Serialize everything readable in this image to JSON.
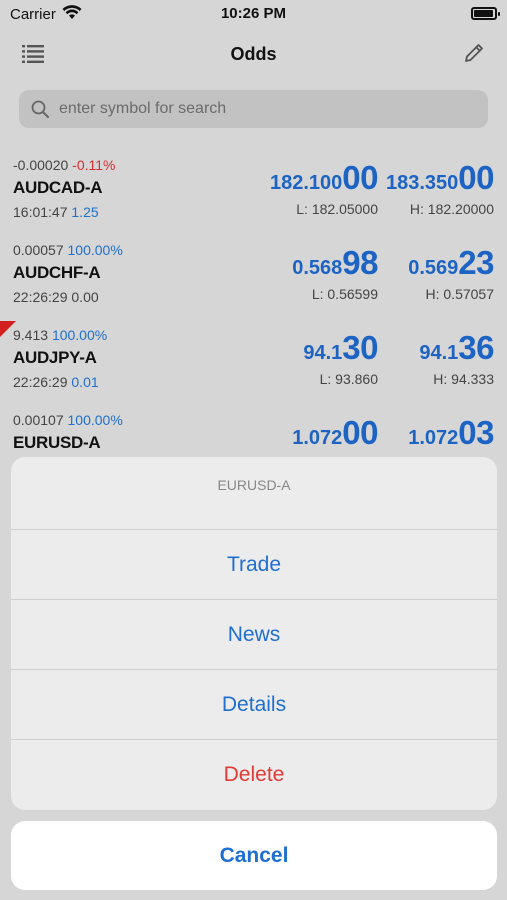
{
  "status_bar": {
    "carrier": "Carrier",
    "time": "10:26 PM"
  },
  "nav": {
    "title": "Odds"
  },
  "search": {
    "placeholder": "enter symbol for search"
  },
  "quotes": [
    {
      "change": "-0.00020",
      "change_pct": "-0.11%",
      "symbol": "AUDCAD-A",
      "time": "16:01:47",
      "spread": "1.25",
      "bid_small": "182.100",
      "bid_big": "00",
      "ask_small": "183.350",
      "ask_big": "00",
      "low": "L: 182.05000",
      "high": "H: 182.20000"
    },
    {
      "change": "0.00057",
      "change_pct": "100.00%",
      "symbol": "AUDCHF-A",
      "time": "22:26:29",
      "spread": "0.00",
      "bid_small": "0.568",
      "bid_big": "98",
      "ask_small": "0.569",
      "ask_big": "23",
      "low": "L: 0.56599",
      "high": "H: 0.57057"
    },
    {
      "change": "9.413",
      "change_pct": "100.00%",
      "symbol": "AUDJPY-A",
      "time": "22:26:29",
      "spread": "0.01",
      "bid_small": "94.1",
      "bid_big": "30",
      "ask_small": "94.1",
      "ask_big": "36",
      "low": "L: 93.860",
      "high": "H: 94.333"
    },
    {
      "change": "0.00107",
      "change_pct": "100.00%",
      "symbol": "EURUSD-A",
      "bid_small": "1.072",
      "bid_big": "00",
      "ask_small": "1.072",
      "ask_big": "03"
    }
  ],
  "action_sheet": {
    "title": "EURUSD-A",
    "actions": [
      "Trade",
      "News",
      "Details",
      "Delete"
    ],
    "cancel": "Cancel"
  },
  "colors": {
    "accent": "#1e6fd0",
    "negative": "#d53030",
    "destructive": "#e53935"
  }
}
